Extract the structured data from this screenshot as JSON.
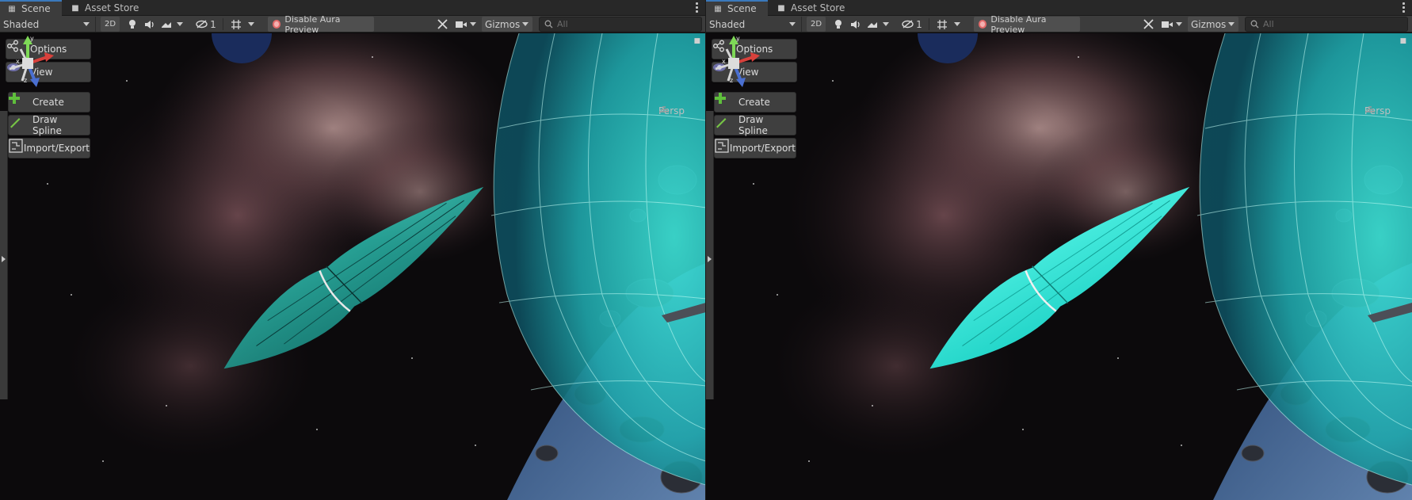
{
  "panels": [
    {
      "tabs": {
        "scene": "Scene",
        "asset_store": "Asset Store"
      },
      "toolbar": {
        "shading_mode": "Shaded",
        "mode_2d": "2D",
        "visibility_count": "1",
        "aura_button": "Disable Aura Preview",
        "gizmos": "Gizmos",
        "search_placeholder": "All"
      },
      "overlay": {
        "options": "Options",
        "view": "View",
        "create": "Create",
        "draw_spline": "Draw Spline",
        "import_export": "Import/Export"
      },
      "orientation": {
        "label": "Persp",
        "axes": [
          "y",
          "x",
          "z"
        ]
      },
      "ship_material": "dim teal"
    },
    {
      "tabs": {
        "scene": "Scene",
        "asset_store": "Asset Store"
      },
      "toolbar": {
        "shading_mode": "Shaded",
        "mode_2d": "2D",
        "visibility_count": "1",
        "aura_button": "Disable Aura Preview",
        "gizmos": "Gizmos",
        "search_placeholder": "All"
      },
      "overlay": {
        "options": "Options",
        "view": "View",
        "create": "Create",
        "draw_spline": "Draw Spline",
        "import_export": "Import/Export"
      },
      "orientation": {
        "label": "Persp",
        "axes": [
          "y",
          "x",
          "z"
        ]
      },
      "ship_material": "bright cyan"
    }
  ],
  "colors": {
    "tab_active_accent": "#3a79bb",
    "toolbar_bg": "#3c3c3c",
    "planet_shield": "#27d6c5",
    "ship_dim": "#1f9f93",
    "ship_bright": "#2bdfd2",
    "nebula": "#a9787a"
  },
  "icons": [
    "grid-icon",
    "lock-icon",
    "light-icon",
    "audio-icon",
    "effects-icon",
    "hidden-eye-icon",
    "grid-snap-icon",
    "tools-icon",
    "camera-icon",
    "search-icon",
    "options-icon",
    "eye-icon",
    "plus-icon",
    "pencil-icon",
    "import-export-icon"
  ]
}
